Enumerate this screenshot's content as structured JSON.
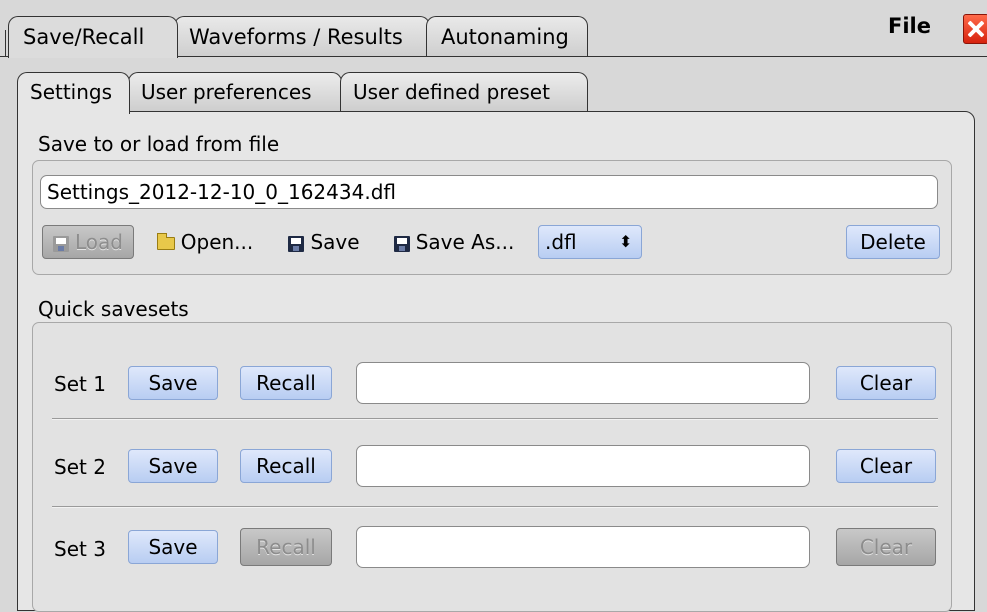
{
  "top_tabs": [
    "Save/Recall",
    "Waveforms / Results",
    "Autonaming"
  ],
  "window_title": "File",
  "sub_tabs": [
    "Settings",
    "User preferences",
    "User defined preset"
  ],
  "file_group": {
    "title": "Save to or load from file",
    "filename": "Settings_2012-12-10_0_162434.dfl",
    "load_label": "Load",
    "open_label": "Open...",
    "save_label": "Save",
    "save_as_label": "Save As...",
    "extension": ".dfl",
    "delete_label": "Delete"
  },
  "quick_group": {
    "title": "Quick savesets",
    "sets": [
      {
        "label": "Set 1",
        "save": "Save",
        "recall": "Recall",
        "value": "",
        "clear": "Clear",
        "recall_enabled": true,
        "clear_enabled": true
      },
      {
        "label": "Set 2",
        "save": "Save",
        "recall": "Recall",
        "value": "",
        "clear": "Clear",
        "recall_enabled": true,
        "clear_enabled": true
      },
      {
        "label": "Set 3",
        "save": "Save",
        "recall": "Recall",
        "value": "",
        "clear": "Clear",
        "recall_enabled": false,
        "clear_enabled": false
      }
    ]
  },
  "colors": {
    "button_blue": "#c6d6f5",
    "disabled_grey": "#b4b4b4",
    "close_red": "#e0321a"
  }
}
